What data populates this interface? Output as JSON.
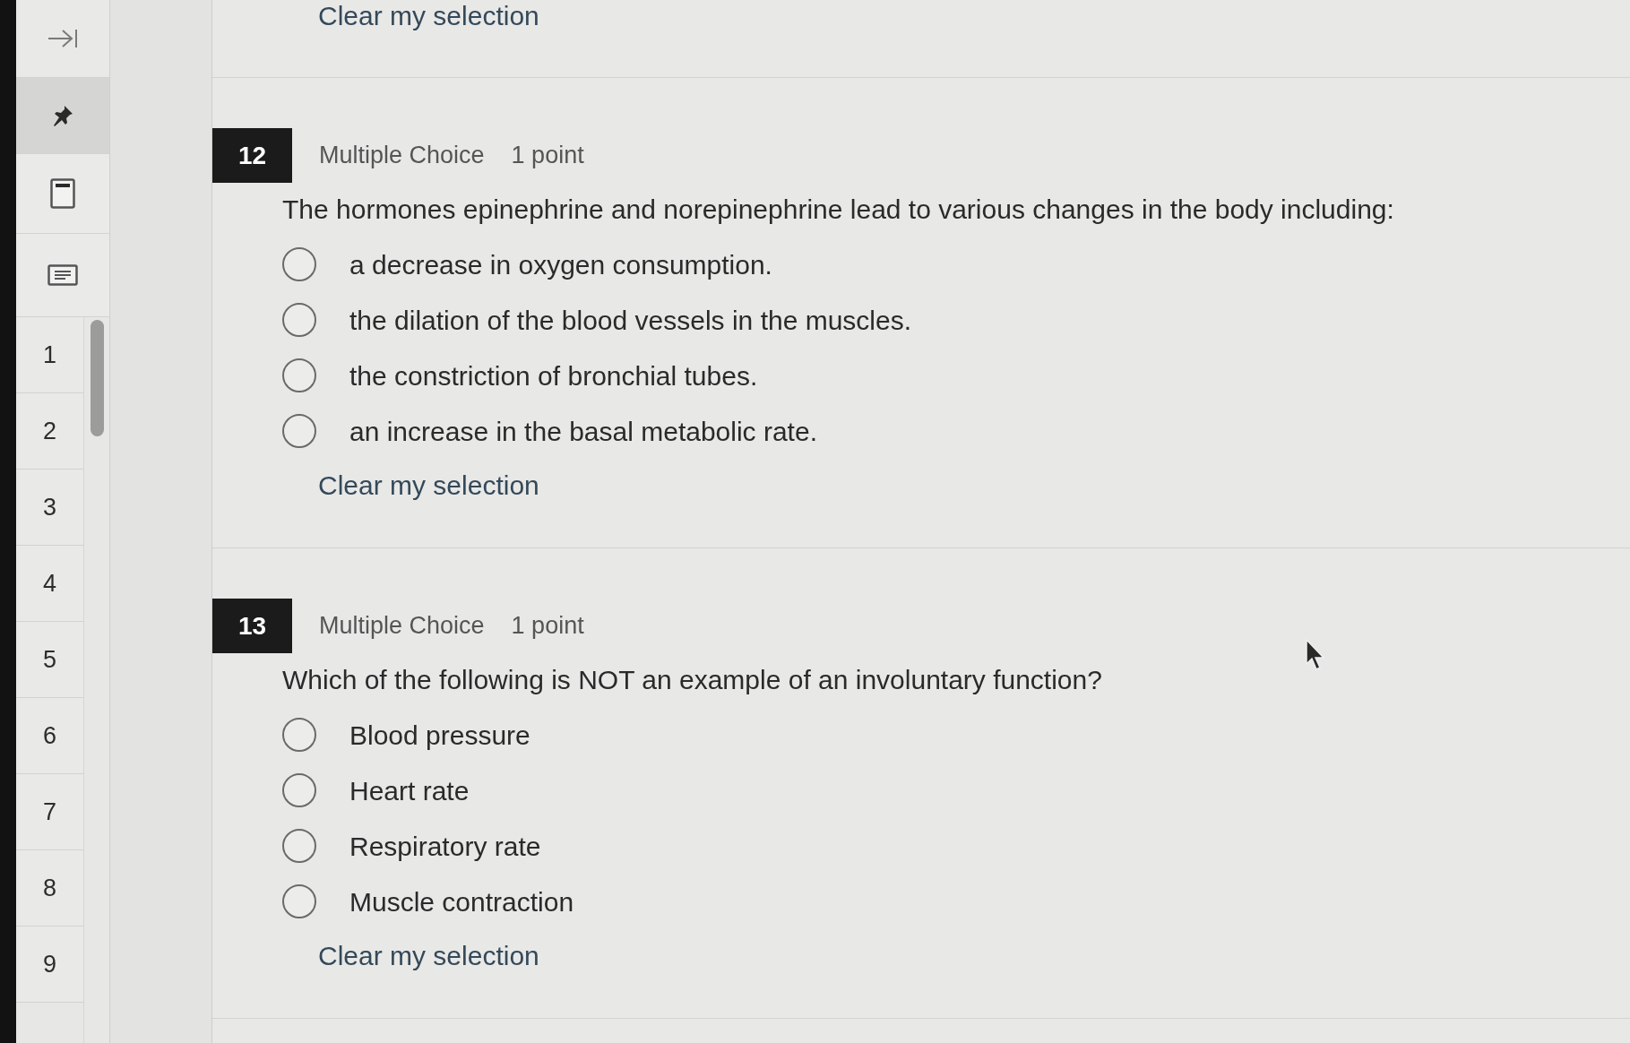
{
  "sidebar": {
    "tools": [
      {
        "kind": "pin",
        "selected": true
      },
      {
        "kind": "calculator",
        "selected": false
      },
      {
        "kind": "notes",
        "selected": false
      }
    ],
    "question_numbers": [
      "1",
      "2",
      "3",
      "4",
      "5",
      "6",
      "7",
      "8",
      "9"
    ]
  },
  "questions": [
    {
      "clear_link": "Clear my selection"
    },
    {
      "number": "12",
      "type": "Multiple Choice",
      "points": "1 point",
      "text": "The hormones epinephrine and norepinephrine lead to various changes in the body including:",
      "options": [
        {
          "label": "a decrease in oxygen consumption.",
          "selected": false
        },
        {
          "label": "the dilation of the blood vessels in the muscles.",
          "selected": false
        },
        {
          "label": "the constriction of bronchial tubes.",
          "selected": false
        },
        {
          "label": "an increase in the basal metabolic rate.",
          "selected": false
        }
      ],
      "clear_link": "Clear my selection"
    },
    {
      "number": "13",
      "type": "Multiple Choice",
      "points": "1 point",
      "text": "Which of the following is NOT an example of an involuntary function?",
      "options": [
        {
          "label": "Blood pressure",
          "selected": false
        },
        {
          "label": "Heart rate",
          "selected": false
        },
        {
          "label": "Respiratory rate",
          "selected": false
        },
        {
          "label": "Muscle contraction",
          "selected": false
        }
      ],
      "clear_link": "Clear my selection"
    }
  ]
}
